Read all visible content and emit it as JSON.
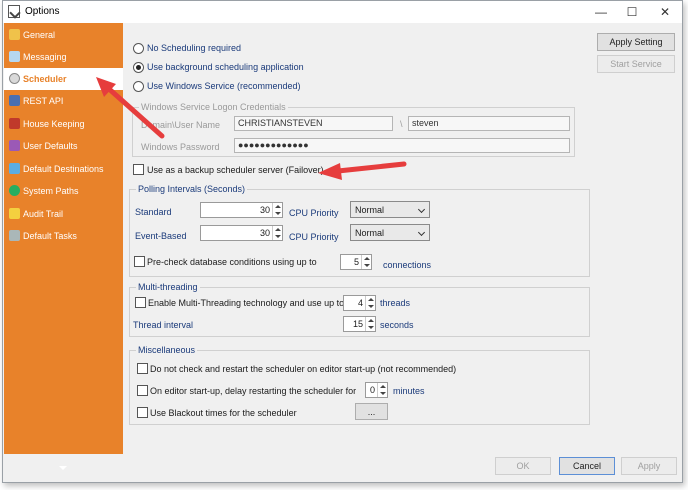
{
  "window": {
    "title": "Options",
    "minimize": "—",
    "maximize": "☐",
    "close": "✕"
  },
  "sidebar": {
    "items": [
      {
        "label": "General",
        "icon": "general-icon",
        "color": "#f0c24a"
      },
      {
        "label": "Messaging",
        "icon": "messaging-icon",
        "color": "#b6d7f0"
      },
      {
        "label": "Scheduler",
        "icon": "clock-icon",
        "color": "#d9d9d9",
        "active": true
      },
      {
        "label": "REST API",
        "icon": "api-icon",
        "color": "#4a6fb0"
      },
      {
        "label": "House Keeping",
        "icon": "housekeeping-icon",
        "color": "#c0392b"
      },
      {
        "label": "User Defaults",
        "icon": "user-defaults-icon",
        "color": "#9b59b6"
      },
      {
        "label": "Default Destinations",
        "icon": "destinations-icon",
        "color": "#5dade2"
      },
      {
        "label": "System Paths",
        "icon": "system-paths-icon",
        "color": "#27ae60"
      },
      {
        "label": "Audit Trail",
        "icon": "audit-trail-icon",
        "color": "#f4d03f"
      },
      {
        "label": "Default Tasks",
        "icon": "tasks-icon",
        "color": "#aab7b8"
      }
    ]
  },
  "scheduling": {
    "options": [
      {
        "label": "No Scheduling required",
        "selected": false
      },
      {
        "label": "Use background scheduling application",
        "selected": true
      },
      {
        "label": "Use Windows Service (recommended)",
        "selected": false
      }
    ],
    "credentials": {
      "legend": "Windows Service Logon Credentials",
      "user_label": "Domain\\User Name",
      "domain_value": "CHRISTIANSTEVEN",
      "separator": "\\",
      "user_value": "steven",
      "password_label": "Windows Password",
      "password_value": "●●●●●●●●●●●●●"
    },
    "failover_label": "Use as a backup scheduler server (Failover)"
  },
  "polling": {
    "legend": "Polling Intervals (Seconds)",
    "standard_label": "Standard",
    "standard_value": "30",
    "eventbased_label": "Event-Based",
    "eventbased_value": "30",
    "cpu_label": "CPU Priority",
    "cpu_standard": "Normal",
    "cpu_eventbased": "Normal",
    "precheck_label": "Pre-check database conditions using up to",
    "precheck_value": "5",
    "connections_label": "connections"
  },
  "multithreading": {
    "legend": "Multi-threading",
    "enable_label": "Enable Multi-Threading technology and use up to",
    "threads_value": "4",
    "threads_label": "threads",
    "interval_label": "Thread interval",
    "interval_value": "15",
    "seconds_label": "seconds"
  },
  "misc": {
    "legend": "Miscellaneous",
    "nocheck_label": "Do not check and restart the scheduler on editor start-up (not recommended)",
    "delay_label": "On editor start-up, delay restarting the scheduler for",
    "delay_value": "0",
    "minutes_label": "minutes",
    "blackout_label": "Use Blackout times for the scheduler",
    "blackout_button": "..."
  },
  "right_buttons": {
    "apply_setting": "Apply Setting",
    "start_service": "Start Service"
  },
  "footer": {
    "ok": "OK",
    "cancel": "Cancel",
    "apply": "Apply"
  },
  "colors": {
    "sidebar": "#e8822a",
    "annotation_arrow": "#e63d3d"
  }
}
